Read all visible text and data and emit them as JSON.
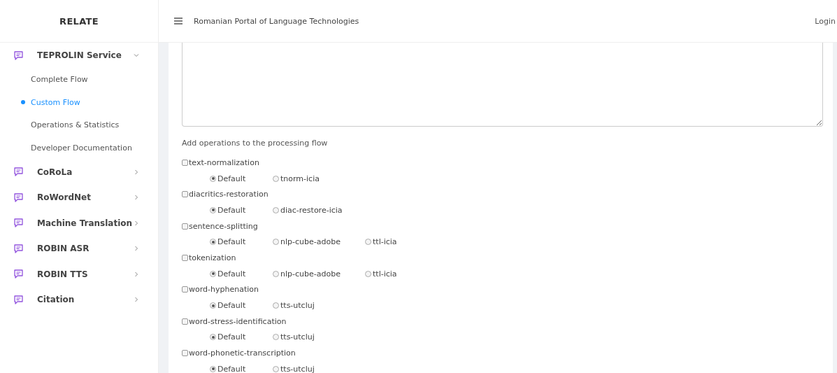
{
  "sidebar": {
    "title": "RELATE",
    "items": [
      {
        "label": "TEPROLIN Service",
        "expanded": true,
        "children": [
          {
            "label": "Complete Flow",
            "selected": false
          },
          {
            "label": "Custom Flow",
            "selected": true
          },
          {
            "label": "Operations & Statistics",
            "selected": false
          },
          {
            "label": "Developer Documentation",
            "selected": false
          }
        ]
      },
      {
        "label": "CoRoLa",
        "expanded": false
      },
      {
        "label": "RoWordNet",
        "expanded": false
      },
      {
        "label": "Machine Translation",
        "expanded": false
      },
      {
        "label": "ROBIN ASR",
        "expanded": false
      },
      {
        "label": "ROBIN TTS",
        "expanded": false
      },
      {
        "label": "Citation",
        "expanded": false
      }
    ]
  },
  "header": {
    "title": "Romanian Portal of Language Technologies",
    "login": "Login"
  },
  "form": {
    "instruction": "Add operations to the processing flow",
    "operations": [
      {
        "name": "text-normalization",
        "checked": false,
        "options": [
          {
            "label": "Default",
            "selected": true
          },
          {
            "label": "tnorm-icia",
            "selected": false
          }
        ]
      },
      {
        "name": "diacritics-restoration",
        "checked": false,
        "options": [
          {
            "label": "Default",
            "selected": true
          },
          {
            "label": "diac-restore-icia",
            "selected": false
          }
        ]
      },
      {
        "name": "sentence-splitting",
        "checked": false,
        "options": [
          {
            "label": "Default",
            "selected": true
          },
          {
            "label": "nlp-cube-adobe",
            "selected": false
          },
          {
            "label": "ttl-icia",
            "selected": false
          }
        ]
      },
      {
        "name": "tokenization",
        "checked": false,
        "options": [
          {
            "label": "Default",
            "selected": true
          },
          {
            "label": "nlp-cube-adobe",
            "selected": false
          },
          {
            "label": "ttl-icia",
            "selected": false
          }
        ]
      },
      {
        "name": "word-hyphenation",
        "checked": false,
        "options": [
          {
            "label": "Default",
            "selected": true
          },
          {
            "label": "tts-utcluj",
            "selected": false
          }
        ]
      },
      {
        "name": "word-stress-identification",
        "checked": false,
        "options": [
          {
            "label": "Default",
            "selected": true
          },
          {
            "label": "tts-utcluj",
            "selected": false
          }
        ]
      },
      {
        "name": "word-phonetic-transcription",
        "checked": false,
        "options": [
          {
            "label": "Default",
            "selected": true
          },
          {
            "label": "tts-utcluj",
            "selected": false
          }
        ]
      }
    ]
  }
}
